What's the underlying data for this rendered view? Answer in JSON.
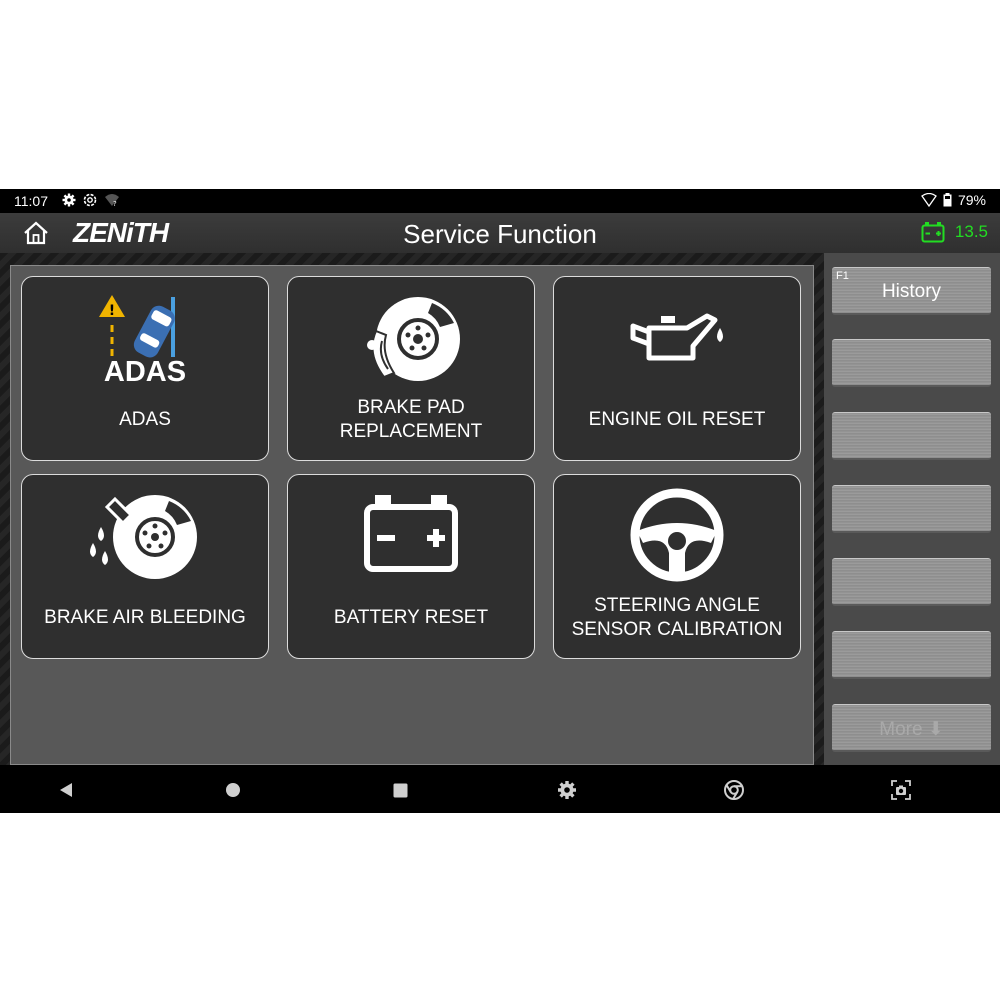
{
  "status_bar": {
    "time": "11:07",
    "battery_percent": "79%",
    "icons": [
      "gear-icon",
      "settings-icon",
      "wifi-question-icon",
      "signal-icon",
      "battery-icon"
    ]
  },
  "header": {
    "logo": "ZENiTH",
    "title": "Service Function",
    "voltage": "13.5",
    "voltage_color": "#22dd22"
  },
  "tiles": [
    {
      "label": "ADAS",
      "icon": "adas-icon",
      "icon_text": "ADAS"
    },
    {
      "label": "BRAKE PAD\nREPLACEMENT",
      "icon": "brake-disc-icon"
    },
    {
      "label": "ENGINE OIL RESET",
      "icon": "oil-can-icon"
    },
    {
      "label": "BRAKE AIR BLEEDING",
      "icon": "brake-bleed-icon"
    },
    {
      "label": "BATTERY RESET",
      "icon": "battery-icon"
    },
    {
      "label": "STEERING ANGLE\nSENSOR CALIBRATION",
      "icon": "steering-wheel-icon"
    }
  ],
  "side_buttons": [
    {
      "key": "F1",
      "label": "History"
    },
    {
      "key": "",
      "label": ""
    },
    {
      "key": "",
      "label": ""
    },
    {
      "key": "",
      "label": ""
    },
    {
      "key": "",
      "label": ""
    },
    {
      "key": "",
      "label": ""
    },
    {
      "key": "",
      "label": "More ⬇"
    }
  ],
  "nav_bar": [
    "back-icon",
    "home-icon",
    "recents-icon",
    "settings-gear-icon",
    "chrome-icon",
    "screenshot-icon"
  ]
}
